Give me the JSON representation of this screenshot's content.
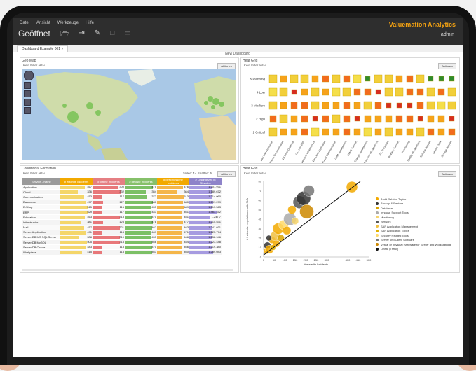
{
  "menu": [
    "Datei",
    "Ansicht",
    "Werkzeuge",
    "Hilfe"
  ],
  "brand": "Valuemation Analytics",
  "document_title": "Geöffnet",
  "user": "admin",
  "tab": "Dashboard Example 001",
  "dashboard_title": "New Dashboard",
  "panels": {
    "map": {
      "title": "Geo Map",
      "filter": "Kein Filter aktiv",
      "button": "Aktionen"
    },
    "grid": {
      "title": "Heat Grid",
      "filter": "Kein Filter aktiv",
      "button": "Aktionen",
      "rows": [
        "5 Planning",
        "4 Low",
        "3 Medium",
        "2 High",
        "1 Critical"
      ],
      "columns": [
        "1st Level Application",
        "1st Level Communication",
        "1st Level Database",
        "1st Level ERP",
        "1st Level Infrastructure",
        "2nd Level Application",
        "2nd Level Communication",
        "CRM Management",
        "CRMS Solution",
        "Change Management",
        "IT Service Management",
        "ITIL Processes",
        "Problem Solution",
        "Provisioning",
        "Quality Management",
        "Release Support",
        "Service Desk",
        "Storage Support"
      ]
    },
    "table": {
      "title": "Conditional Formation",
      "filter": "Kein Filter aktiv",
      "info": "Zeilen: 14 Spalten: 5",
      "button": "Aktionen",
      "headers": [
        "Service - Name",
        "# erstellte Incidents",
        "# offene Incidents",
        "# gelöste Incidents",
        "# geschlossene Incidents",
        "# Lösungszeit in Stunden"
      ],
      "rows": [
        [
          "Application",
          "467",
          "300",
          "475",
          "476",
          "1.201.971"
        ],
        [
          "Cloud",
          "336",
          "332",
          "354",
          "364",
          "1.189.672"
        ],
        [
          "Communication",
          "453",
          "117",
          "372",
          "513",
          "1.214.060"
        ],
        [
          "Datacenter",
          "477",
          "127",
          "480",
          "480",
          "1.291.299"
        ],
        [
          "E-Shop",
          "515",
          "116",
          "453",
          "489",
          "1.213.563"
        ],
        [
          "ERP",
          "529",
          "117",
          "443",
          "461",
          "1.463.452"
        ],
        [
          "Education",
          "463",
          "318",
          "470",
          "451",
          "1.247.7"
        ],
        [
          "Infrastructur",
          "381",
          "125",
          "478",
          "477",
          "1.215.531"
        ],
        [
          "Mail",
          "457",
          "321",
          "467",
          "463",
          "1.241.031"
        ],
        [
          "Server Application",
          "491",
          "118",
          "449",
          "471",
          "1.225.774"
        ],
        [
          "Server DB MS SQL Server",
          "338",
          "319",
          "453",
          "466",
          "1.252.946"
        ],
        [
          "Server DB MySQL",
          "505",
          "318",
          "466",
          "454",
          "1.223.448"
        ],
        [
          "Server DB Oracle",
          "483",
          "118",
          "470",
          "466",
          "1.219.380"
        ],
        [
          "Workplace",
          "415",
          "118",
          "463",
          "460",
          "1.289.043"
        ]
      ]
    },
    "scatter": {
      "title": "Heat Grid",
      "filter": "Kein Filter aktiv",
      "button": "Aktionen"
    }
  },
  "chart_data": [
    {
      "type": "heatmap",
      "title": "Heat Grid",
      "rows": [
        "5 Planning",
        "4 Low",
        "3 Medium",
        "2 High",
        "1 Critical"
      ],
      "columns_count": 18,
      "values": [
        [
          4,
          3,
          4,
          4,
          3,
          2,
          4,
          2,
          5,
          0,
          4,
          4,
          3,
          2,
          4,
          0,
          0,
          0
        ],
        [
          5,
          4,
          1,
          3,
          4,
          3,
          5,
          4,
          2,
          2,
          1,
          4,
          4,
          2,
          2,
          4,
          2,
          4
        ],
        [
          4,
          3,
          2,
          2,
          4,
          3,
          3,
          2,
          3,
          4,
          2,
          1,
          1,
          1,
          2,
          4,
          5,
          4
        ],
        [
          2,
          4,
          3,
          2,
          1,
          2,
          4,
          2,
          1,
          3,
          3,
          3,
          2,
          2,
          1,
          3,
          3,
          1
        ],
        [
          4,
          3,
          3,
          2,
          5,
          3,
          3,
          2,
          3,
          5,
          3,
          4,
          3,
          3,
          4,
          2,
          3,
          2
        ]
      ]
    },
    {
      "type": "scatter",
      "xlabel": "# erstellte Incidents",
      "ylabel": "# Incidents vergeht innerhalb SLA",
      "xlim": [
        0,
        500
      ],
      "ylim": [
        0,
        80
      ],
      "xticks": [
        0,
        50,
        100,
        150,
        200,
        250,
        300,
        400,
        450,
        500
      ],
      "yticks": [
        0,
        10,
        20,
        30,
        40,
        50,
        60,
        70,
        80
      ],
      "legend": [
        "Audit Related Topics",
        "Backup & Restore",
        "Database",
        "Inhouse Support Tools",
        "Monitoring",
        "Network",
        "SAP Application Management",
        "SAP Application Topics",
        "Security Related Tools",
        "Server und Client Software",
        "Virtual or physical Hardware for Server and Workstations",
        "Linear (Trend)"
      ],
      "legend_colors": [
        "#f2a900",
        "#333333",
        "#d9a300",
        "#aaaaaa",
        "#f5d36b",
        "#555555",
        "#f0c040",
        "#e0b000",
        "#ffd966",
        "#777777",
        "#cc8800",
        "#111111"
      ],
      "points": [
        {
          "x": 12,
          "y": 6,
          "r": 4,
          "s": 0
        },
        {
          "x": 18,
          "y": 12,
          "r": 5,
          "s": 1
        },
        {
          "x": 28,
          "y": 8,
          "r": 6,
          "s": 0
        },
        {
          "x": 40,
          "y": 18,
          "r": 5,
          "s": 0
        },
        {
          "x": 55,
          "y": 22,
          "r": 7,
          "s": 6
        },
        {
          "x": 70,
          "y": 30,
          "r": 8,
          "s": 0
        },
        {
          "x": 82,
          "y": 20,
          "r": 5,
          "s": 2
        },
        {
          "x": 95,
          "y": 34,
          "r": 7,
          "s": 8
        },
        {
          "x": 110,
          "y": 28,
          "r": 6,
          "s": 0
        },
        {
          "x": 125,
          "y": 40,
          "r": 9,
          "s": 3
        },
        {
          "x": 150,
          "y": 38,
          "r": 5,
          "s": 4
        },
        {
          "x": 170,
          "y": 58,
          "r": 9,
          "s": 5
        },
        {
          "x": 190,
          "y": 62,
          "r": 10,
          "s": 1
        },
        {
          "x": 205,
          "y": 48,
          "r": 10,
          "s": 10
        },
        {
          "x": 215,
          "y": 70,
          "r": 8,
          "s": 9
        },
        {
          "x": 45,
          "y": 10,
          "r": 4,
          "s": 7
        },
        {
          "x": 60,
          "y": 14,
          "r": 5,
          "s": 0
        },
        {
          "x": 25,
          "y": 20,
          "r": 4,
          "s": 1
        },
        {
          "x": 420,
          "y": 74,
          "r": 8,
          "s": 0
        },
        {
          "x": 135,
          "y": 50,
          "r": 6,
          "s": 0
        }
      ],
      "trend": [
        [
          0,
          2
        ],
        [
          460,
          80
        ]
      ]
    }
  ]
}
